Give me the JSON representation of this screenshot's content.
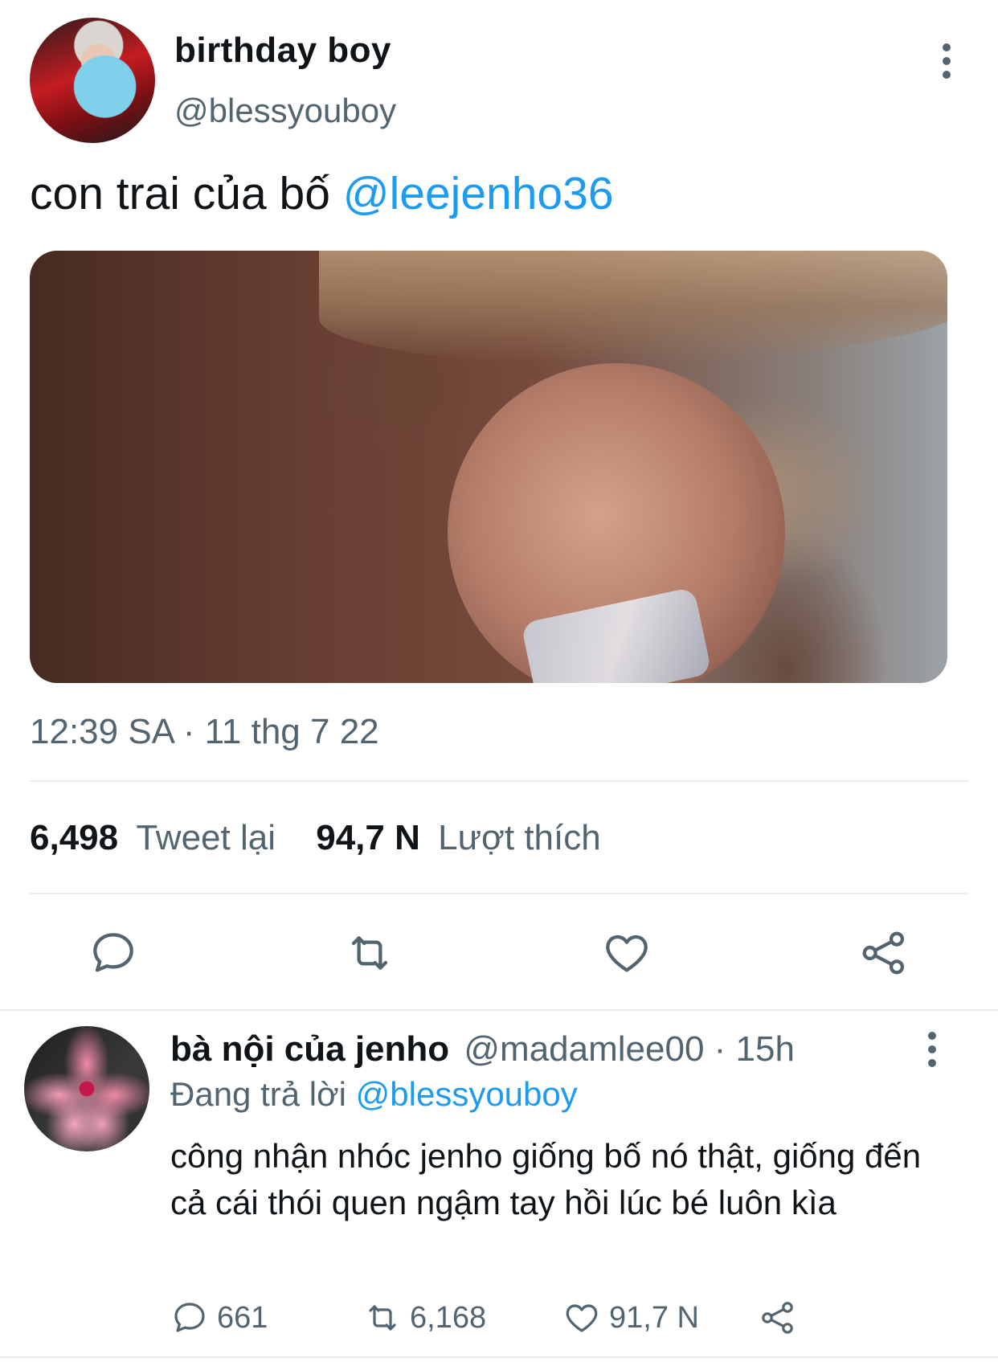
{
  "tweet": {
    "display_name": "birthday boy",
    "handle": "@blessyouboy",
    "text": "con trai của bố ",
    "mention": "@leejenho36",
    "timestamp": "12:39 SA · 11 thg 7 22",
    "retweets_count": "6,498",
    "retweets_label": "Tweet lại",
    "likes_count": "94,7 N",
    "likes_label": "Lượt thích"
  },
  "actions": [
    {
      "icon": "reply-icon"
    },
    {
      "icon": "retweet-icon"
    },
    {
      "icon": "like-icon"
    },
    {
      "icon": "share-icon"
    }
  ],
  "reply": {
    "display_name": "bà nội của jenho",
    "handle": "@madamlee00",
    "time": " · 15h",
    "replying_label": "Đang trả lời ",
    "replying_to": "@blessyouboy",
    "text": "công nhận nhóc jenho giống bố nó thật, giống đến cả cái thói quen ngậm tay hồi lúc bé luôn kìa",
    "reply_count": "661",
    "retweet_count": "6,168",
    "like_count": "91,7 N"
  },
  "colors": {
    "accent": "#1d9bf0",
    "secondary_text": "#536471",
    "primary_text": "#0f1419",
    "divider": "#e6ecf0"
  }
}
